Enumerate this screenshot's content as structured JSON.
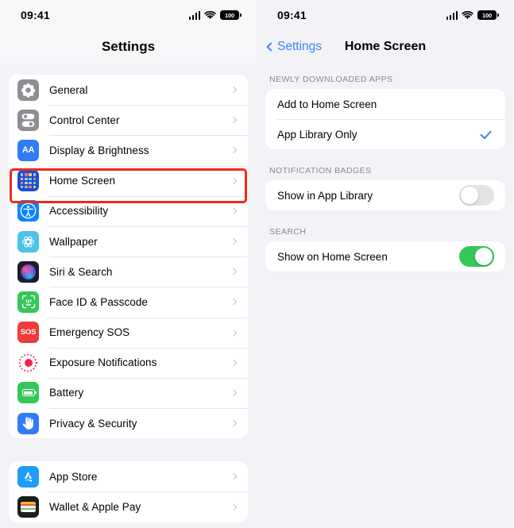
{
  "status_bar": {
    "time": "09:41",
    "battery_level": "100",
    "signal_icon": "cellular-signal-icon",
    "wifi_icon": "wifi-icon",
    "battery_icon": "battery-icon"
  },
  "left_panel": {
    "nav_title": "Settings",
    "groups": [
      {
        "items": [
          {
            "label": "General",
            "icon": "gear-icon"
          },
          {
            "label": "Control Center",
            "icon": "control-center-icon"
          },
          {
            "label": "Display & Brightness",
            "icon": "display-brightness-icon",
            "glyph": "AA"
          },
          {
            "label": "Home Screen",
            "icon": "home-screen-icon",
            "highlighted": true
          },
          {
            "label": "Accessibility",
            "icon": "accessibility-icon"
          },
          {
            "label": "Wallpaper",
            "icon": "wallpaper-icon"
          },
          {
            "label": "Siri & Search",
            "icon": "siri-icon"
          },
          {
            "label": "Face ID & Passcode",
            "icon": "face-id-icon"
          },
          {
            "label": "Emergency SOS",
            "icon": "emergency-sos-icon",
            "glyph": "SOS"
          },
          {
            "label": "Exposure Notifications",
            "icon": "exposure-notifications-icon"
          },
          {
            "label": "Battery",
            "icon": "battery-settings-icon"
          },
          {
            "label": "Privacy & Security",
            "icon": "privacy-security-icon"
          }
        ]
      },
      {
        "items": [
          {
            "label": "App Store",
            "icon": "app-store-icon"
          },
          {
            "label": "Wallet & Apple Pay",
            "icon": "wallet-icon"
          }
        ]
      }
    ]
  },
  "right_panel": {
    "back_label": "Settings",
    "nav_title": "Home Screen",
    "back_icon": "chevron-left-icon",
    "sections": [
      {
        "header": "NEWLY DOWNLOADED APPS",
        "rows": [
          {
            "label": "Add to Home Screen",
            "control": "none"
          },
          {
            "label": "App Library Only",
            "control": "checkmark",
            "checked": true
          }
        ]
      },
      {
        "header": "NOTIFICATION BADGES",
        "rows": [
          {
            "label": "Show in App Library",
            "control": "toggle",
            "on": false
          }
        ]
      },
      {
        "header": "SEARCH",
        "rows": [
          {
            "label": "Show on Home Screen",
            "control": "toggle",
            "on": true
          }
        ]
      }
    ]
  },
  "colors": {
    "accent_blue": "#3a84f7",
    "toggle_on_green": "#34c759",
    "toggle_off_gray": "#e4e4e6",
    "highlight_red": "#ee2b16",
    "page_background": "#f2f2f7",
    "card_background": "#ffffff",
    "section_header_gray": "#8a8a8e"
  }
}
